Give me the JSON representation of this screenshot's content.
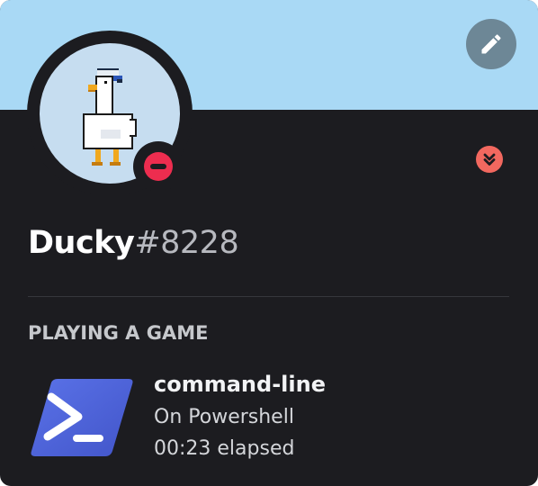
{
  "profile": {
    "username": "Ducky",
    "discriminator": "#8228",
    "status": "do-not-disturb",
    "banner_color": "#a9d9f5",
    "status_color": "#ed2d4f",
    "badge_color": "#f2685f"
  },
  "icons": {
    "edit": "pencil-icon",
    "badge": "chevron-down-icon",
    "game": "powershell-icon"
  },
  "activity": {
    "section_title": "PLAYING A GAME",
    "name": "command-line",
    "details": "On Powershell",
    "elapsed": "00:23 elapsed"
  }
}
